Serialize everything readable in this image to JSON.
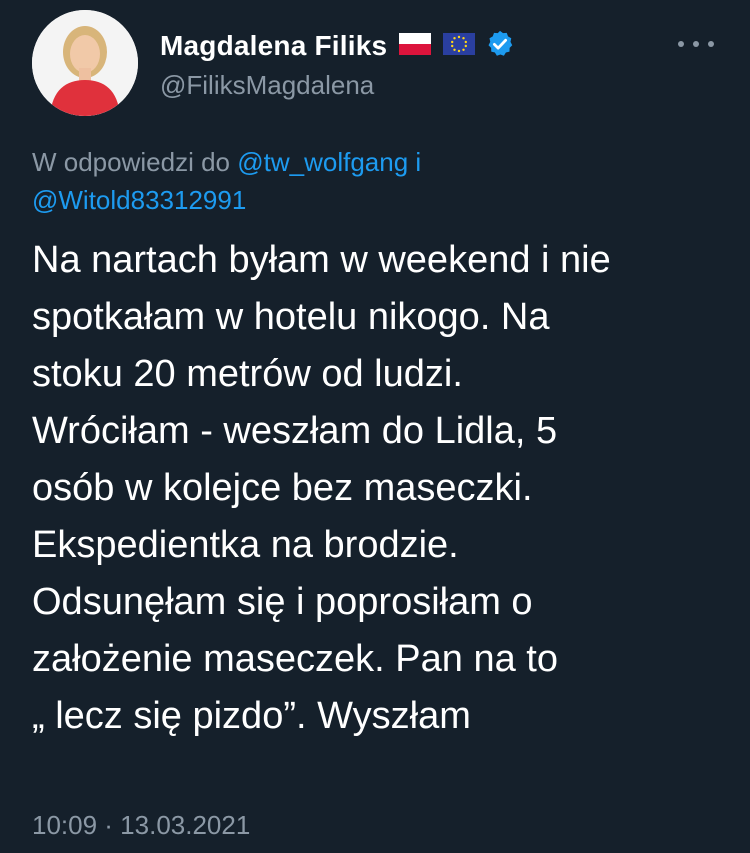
{
  "author": {
    "display_name": "Magdalena Filiks",
    "handle": "@FiliksMagdalena",
    "badges": [
      "poland-flag-icon",
      "eu-flag-icon",
      "verified-badge-icon"
    ]
  },
  "more_button": {
    "icon": "more-dots-icon"
  },
  "reply_context": {
    "prefix": "W odpowiedzi do ",
    "mention_1": "@tw_wolfgang",
    "conjunction": "i",
    "mention_2": "@Witold83312991"
  },
  "tweet": {
    "lines": [
      "Na nartach byłam w weekend i nie",
      "spotkałam w hotelu nikogo. Na",
      "stoku 20 metrów od ludzi.",
      "Wróciłam - weszłam do Lidla, 5",
      "osób w kolejce bez maseczki.",
      "Ekspedientka na brodzie.",
      "Odsunęłam się i poprosiłam o",
      "założenie maseczek. Pan na to",
      "„ lecz się pizdo”. Wyszłam"
    ],
    "timestamp": "10:09 · 13.03.2021"
  },
  "colors": {
    "background": "#15202b",
    "text": "#ffffff",
    "secondary_text": "#8b98a5",
    "link": "#1d9bf0"
  }
}
